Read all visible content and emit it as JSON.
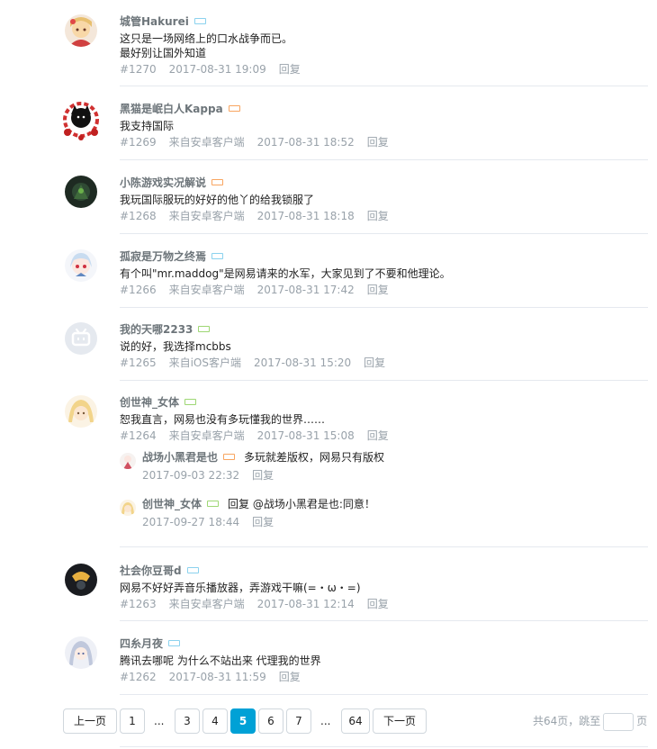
{
  "comments": [
    {
      "user": "城管Hakurei",
      "level_color": "#8bd2ee",
      "text": [
        "这只是一场网络上的口水战争而已。",
        "最好别让国外知道"
      ],
      "floor": "#1270",
      "source": "",
      "time": "2017-08-31 19:09",
      "reply": "回复"
    },
    {
      "user": "黑猫是岷白人Kappa",
      "level_color": "#f8a560",
      "text": [
        "我支持国际"
      ],
      "floor": "#1269",
      "source": "来自安卓客户端",
      "time": "2017-08-31 18:52",
      "reply": "回复"
    },
    {
      "user": "小陈游戏实况解说",
      "level_color": "#f8a560",
      "text": [
        "我玩国际服玩的好好的他丫的给我锁服了"
      ],
      "floor": "#1268",
      "source": "来自安卓客户端",
      "time": "2017-08-31 18:18",
      "reply": "回复"
    },
    {
      "user": "孤寂是万物之终焉",
      "level_color": "#8bd2ee",
      "text": [
        "有个叫\"mr.maddog\"是网易请来的水军，大家见到了不要和他理论。"
      ],
      "floor": "#1266",
      "source": "来自安卓客户端",
      "time": "2017-08-31 17:42",
      "reply": "回复"
    },
    {
      "user": "我的天哪2233",
      "level_color": "#9ed774",
      "text": [
        "说的好，我选择mcbbs"
      ],
      "floor": "#1265",
      "source": "来自iOS客户端",
      "time": "2017-08-31 15:20",
      "reply": "回复"
    },
    {
      "user": "创世神_女体",
      "level_color": "#9ed774",
      "text": [
        "恕我直言，网易也没有多玩懂我的世界……"
      ],
      "floor": "#1264",
      "source": "来自安卓客户端",
      "time": "2017-08-31 15:08",
      "reply": "回复"
    },
    {
      "user": "社会你豆哥d",
      "level_color": "#8bd2ee",
      "text": [
        "网易不好好弄音乐播放器，弄游戏干嘛(=・ω・=)"
      ],
      "floor": "#1263",
      "source": "来自安卓客户端",
      "time": "2017-08-31 12:14",
      "reply": "回复"
    },
    {
      "user": "四糸月夜",
      "level_color": "#8bd2ee",
      "text": [
        "腾讯去哪呢 为什么不站出来 代理我的世界"
      ],
      "floor": "#1262",
      "source": "",
      "time": "2017-08-31 11:59",
      "reply": "回复"
    }
  ],
  "subreplies": [
    {
      "user": "战场小黑君是也",
      "level_color": "#f8a560",
      "text": "多玩就差版权，网易只有版权",
      "time": "2017-09-03 22:32",
      "reply": "回复"
    },
    {
      "user": "创世神_女体",
      "level_color": "#9ed774",
      "text": "回复 @战场小黑君是也:同意！",
      "time": "2017-09-27 18:44",
      "reply": "回复"
    }
  ],
  "pager": {
    "prev": "上一页",
    "next": "下一页",
    "pages": [
      "1",
      "3",
      "4",
      "5",
      "6",
      "7",
      "64"
    ],
    "ellipsis": "...",
    "current": "5",
    "total_text": "共64页，跳至",
    "page_unit": "页"
  },
  "colors": {
    "accent": "#00a1d6",
    "meta": "#99a2aa",
    "username": "#6d757a"
  }
}
